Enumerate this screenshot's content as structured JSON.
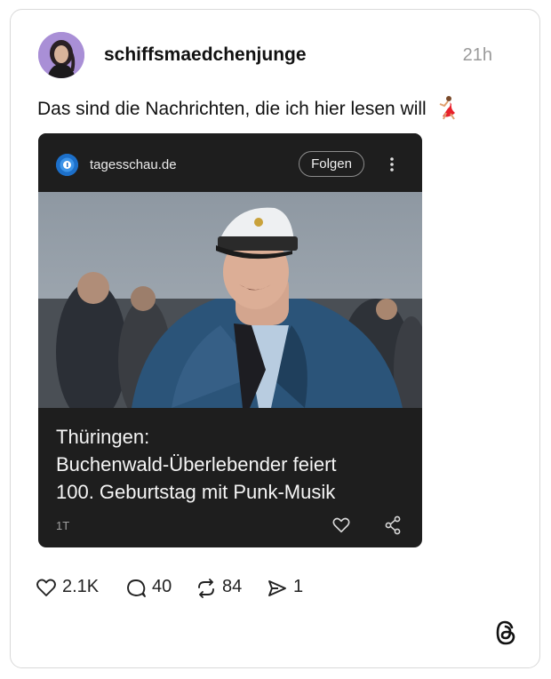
{
  "post": {
    "username": "schiffsmaedchenjunge",
    "time": "21h",
    "text": "Das sind die Nachrichten, die ich hier lesen will",
    "emoji_icon": "dancer-emoji-icon"
  },
  "news_card": {
    "source": "tagesschau.de",
    "follow_label": "Folgen",
    "headline_lines": [
      "Thüringen:",
      "Buchenwald-Überlebender feiert",
      "100. Geburtstag mit Punk-Musik"
    ],
    "age": "1T",
    "background_color": "#1e1e1e",
    "source_logo_color": "#1c6fc9"
  },
  "actions": {
    "likes": "2.1K",
    "comments": "40",
    "reposts": "84",
    "shares": "1"
  },
  "icons": {
    "like": "heart-icon",
    "comment": "comment-bubble-icon",
    "repost": "repost-arrows-icon",
    "share": "send-icon",
    "app": "threads-logo-icon"
  }
}
